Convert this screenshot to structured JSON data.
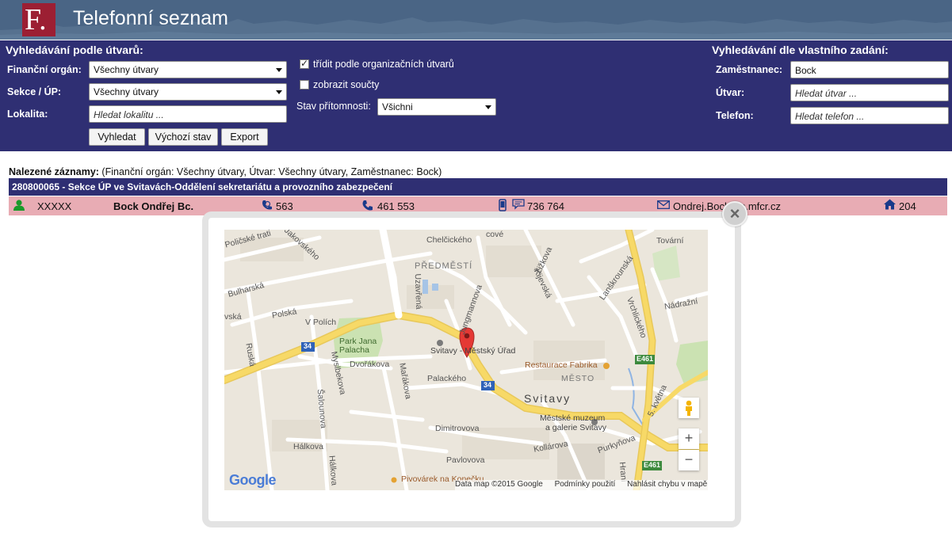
{
  "header": {
    "logo_text": "F.",
    "title": "Telefonní seznam"
  },
  "search_units": {
    "title": "Vyhledávání podle útvarů:",
    "financni_organ_label": "Finanční orgán:",
    "financni_organ_value": "Všechny útvary",
    "sekce_label": "Sekce / ÚP:",
    "sekce_value": "Všechny útvary",
    "lokalita_label": "Lokalita:",
    "lokalita_placeholder": "Hledat lokalitu ...",
    "sort_label": "třídit podle organizačních útvarů",
    "sort_checked": true,
    "totals_label": "zobrazit součty",
    "totals_checked": false,
    "presence_label": "Stav přítomnosti:",
    "presence_value": "Všichni",
    "buttons": {
      "search": "Vyhledat",
      "reset": "Výchozí stav",
      "export": "Export"
    }
  },
  "search_custom": {
    "title": "Vyhledávání dle vlastního zadání:",
    "employee_label": "Zaměstnanec:",
    "employee_value": "Bock",
    "unit_label": "Útvar:",
    "unit_placeholder": "Hledat útvar ...",
    "phone_label": "Telefon:",
    "phone_placeholder": "Hledat telefon ..."
  },
  "results": {
    "found_label": "Nalezené záznamy:",
    "found_filter": "(Finanční orgán: Všechny útvary, Útvar: Všechny útvary, Zaměstnanec: Bock)",
    "group_title": "280800065 - Sekce ÚP ve Svitavách-Oddělení sekretariátu a provozního zabezpečení",
    "row": {
      "id": "XXXXX",
      "name": "Bock Ondřej Bc.",
      "internal": "563",
      "phone": "461 553",
      "mobile": "736 764",
      "email": "Ondrej.Bock@s.mfcr.cz",
      "room": "204"
    }
  },
  "map": {
    "close_symbol": "×",
    "zoom_in": "+",
    "zoom_out": "−",
    "google_logo": "Google",
    "attribution": [
      "Data map ©2015 Google",
      "Podmínky použití",
      "Nahlásit chybu v mapě"
    ],
    "labels": {
      "policske_trati": "Poličské trati",
      "jakovskeho": "Jakovského",
      "chelcickeho": "Chelčického",
      "predmesti": "PŘEDMĚSTÍ",
      "zizkova": "Žižkova",
      "tovarni": "Tovární",
      "bulharska": "Bulharská",
      "uzavrena": "Uzavřená",
      "jungmannova": "Jungmannova",
      "kijevska": "Kijevská",
      "lanskrounska": "Lanškrounská",
      "nadrazni": "Nádražní",
      "vska": "vská",
      "polska": "Polská",
      "v_polich": "V Polích",
      "vrchlickeho": "Vrchlického",
      "ruska": "Ruská",
      "park": "Park Jana Palacha",
      "marker_label": "Svitavy - Městský Úřad",
      "restaurace": "Restaurace Fabrika",
      "mesto": "MĚSTO",
      "myslbekova": "Myslbekova",
      "dvorakova": "Dvořákova",
      "marakova": "Mařákova",
      "palackeho": "Palackého",
      "svitavy": "Svitavy",
      "kvetna": "5. května",
      "salounova": "Šalounova",
      "muzeum_1": "Městské muzeum",
      "muzeum_2": "a galerie Svitavy",
      "dimitrovova": "Dimitrovova",
      "kollarova": "Kollárova",
      "purkynova": "Purkyňova",
      "halkova": "Hálkova",
      "pavlovova": "Pavlovova",
      "hrani": "Hraní",
      "pivovarek": "Pivovárek na Konečku",
      "road_34_a": "34",
      "road_34_b": "34",
      "e461_a": "E461",
      "e461_b": "E461"
    }
  }
}
